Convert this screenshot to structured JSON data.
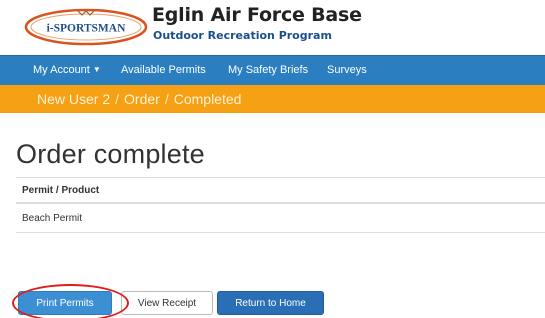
{
  "header": {
    "logo_text": "i-SPORTSMAN",
    "title": "Eglin Air Force Base",
    "subtitle": "Outdoor Recreation Program"
  },
  "nav": {
    "items": [
      {
        "label": "My Account",
        "has_dropdown": true
      },
      {
        "label": "Available Permits"
      },
      {
        "label": "My Safety Briefs"
      },
      {
        "label": "Surveys"
      }
    ]
  },
  "breadcrumb": {
    "items": [
      "New User 2",
      "Order",
      "Completed"
    ],
    "separator": "/"
  },
  "main": {
    "title": "Order complete",
    "table": {
      "header": "Permit / Product",
      "rows": [
        "Beach Permit"
      ]
    }
  },
  "actions": {
    "print_label": "Print Permits",
    "receipt_label": "View Receipt",
    "home_label": "Return to Home"
  },
  "colors": {
    "nav_bg": "#2b7fc1",
    "breadcrumb_bg": "#f6a013",
    "primary_button": "#3d8fd4",
    "home_button": "#2a6fb5",
    "highlight": "#e01c1c"
  }
}
